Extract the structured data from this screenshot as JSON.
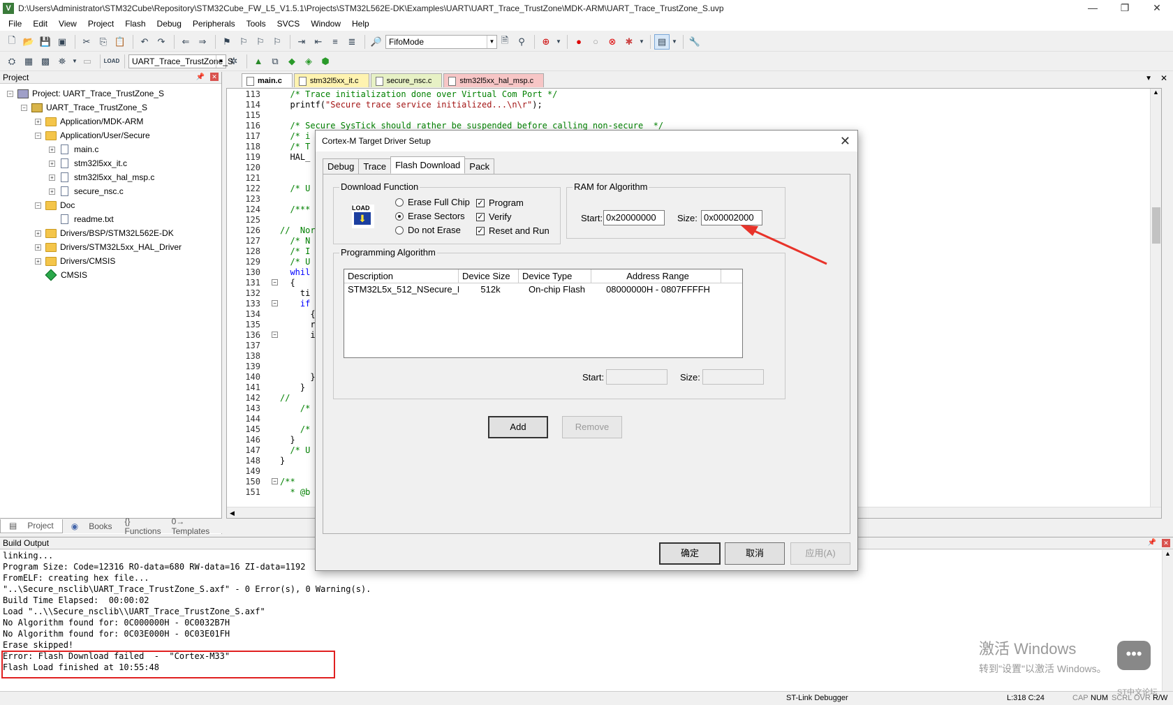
{
  "window": {
    "title": "D:\\Users\\Administrator\\STM32Cube\\Repository\\STM32Cube_FW_L5_V1.5.1\\Projects\\STM32L562E-DK\\Examples\\UART\\UART_Trace_TrustZone\\MDK-ARM\\UART_Trace_TrustZone_S.uvp",
    "app_icon": "V"
  },
  "menu": [
    "File",
    "Edit",
    "View",
    "Project",
    "Flash",
    "Debug",
    "Peripherals",
    "Tools",
    "SVCS",
    "Window",
    "Help"
  ],
  "toolbar": {
    "find_combo": "FifoMode",
    "target_combo": "UART_Trace_TrustZone_S"
  },
  "project_panel": {
    "title": "Project",
    "tree": [
      {
        "label": "Project: UART_Trace_TrustZone_S",
        "icon": "proj",
        "level": 0,
        "exp": "−"
      },
      {
        "label": "UART_Trace_TrustZone_S",
        "icon": "target",
        "level": 1,
        "exp": "−"
      },
      {
        "label": "Application/MDK-ARM",
        "icon": "folder",
        "level": 2,
        "exp": "+"
      },
      {
        "label": "Application/User/Secure",
        "icon": "folder",
        "level": 2,
        "exp": "−"
      },
      {
        "label": "main.c",
        "icon": "file",
        "level": 3,
        "exp": "+"
      },
      {
        "label": "stm32l5xx_it.c",
        "icon": "file",
        "level": 3,
        "exp": "+"
      },
      {
        "label": "stm32l5xx_hal_msp.c",
        "icon": "file",
        "level": 3,
        "exp": "+"
      },
      {
        "label": "secure_nsc.c",
        "icon": "file",
        "level": 3,
        "exp": "+"
      },
      {
        "label": "Doc",
        "icon": "folder",
        "level": 2,
        "exp": "−"
      },
      {
        "label": "readme.txt",
        "icon": "file",
        "level": 3,
        "exp": ""
      },
      {
        "label": "Drivers/BSP/STM32L562E-DK",
        "icon": "folder",
        "level": 2,
        "exp": "+"
      },
      {
        "label": "Drivers/STM32L5xx_HAL_Driver",
        "icon": "folder",
        "level": 2,
        "exp": "+"
      },
      {
        "label": "Drivers/CMSIS",
        "icon": "folder",
        "level": 2,
        "exp": "+"
      },
      {
        "label": "CMSIS",
        "icon": "diamond",
        "level": 2,
        "exp": ""
      }
    ],
    "tabs": [
      "Project",
      "Books",
      "{} Functions",
      "0→ Templates"
    ]
  },
  "editor_tabs": [
    "main.c",
    "stm32l5xx_it.c",
    "secure_nsc.c",
    "stm32l5xx_hal_msp.c"
  ],
  "code_lines": [
    {
      "n": "113",
      "fold": "",
      "code": "  /* Trace initialization done over Virtual Com Port */",
      "cls": "cmt"
    },
    {
      "n": "114",
      "fold": "",
      "code": "  printf(\"Secure trace service initialized...\\n\\r\");",
      "cls": "mixed"
    },
    {
      "n": "115",
      "fold": "",
      "code": "",
      "cls": ""
    },
    {
      "n": "116",
      "fold": "",
      "code": "  /* Secure SysTick should rather be suspended before calling non-secure  */",
      "cls": "cmt"
    },
    {
      "n": "117",
      "fold": "",
      "code": "  /* i",
      "cls": "cmt"
    },
    {
      "n": "118",
      "fold": "",
      "code": "  /* T",
      "cls": "cmt"
    },
    {
      "n": "119",
      "fold": "",
      "code": "  HAL_",
      "cls": ""
    },
    {
      "n": "120",
      "fold": "",
      "code": "",
      "cls": ""
    },
    {
      "n": "121",
      "fold": "",
      "code": "",
      "cls": ""
    },
    {
      "n": "122",
      "fold": "",
      "code": "  /* U",
      "cls": "cmt"
    },
    {
      "n": "123",
      "fold": "",
      "code": "",
      "cls": ""
    },
    {
      "n": "124",
      "fold": "",
      "code": "  /***",
      "cls": "cmt"
    },
    {
      "n": "125",
      "fold": "",
      "code": "",
      "cls": ""
    },
    {
      "n": "126",
      "fold": "",
      "code": "//  Nor",
      "cls": "cmt"
    },
    {
      "n": "127",
      "fold": "",
      "code": "  /* N",
      "cls": "cmt"
    },
    {
      "n": "128",
      "fold": "",
      "code": "  /* I",
      "cls": "cmt"
    },
    {
      "n": "129",
      "fold": "",
      "code": "  /* U",
      "cls": "cmt"
    },
    {
      "n": "130",
      "fold": "",
      "code": "  whil",
      "cls": "kw"
    },
    {
      "n": "131",
      "fold": "−",
      "code": "  {",
      "cls": ""
    },
    {
      "n": "132",
      "fold": "",
      "code": "    ti",
      "cls": ""
    },
    {
      "n": "133",
      "fold": "−",
      "code": "    if",
      "cls": "kw"
    },
    {
      "n": "134",
      "fold": "",
      "code": "      {",
      "cls": ""
    },
    {
      "n": "135",
      "fold": "",
      "code": "      r",
      "cls": ""
    },
    {
      "n": "136",
      "fold": "−",
      "code": "      i",
      "cls": ""
    },
    {
      "n": "137",
      "fold": "",
      "code": "",
      "cls": ""
    },
    {
      "n": "138",
      "fold": "",
      "code": "",
      "cls": ""
    },
    {
      "n": "139",
      "fold": "",
      "code": "",
      "cls": ""
    },
    {
      "n": "140",
      "fold": "",
      "code": "      }",
      "cls": ""
    },
    {
      "n": "141",
      "fold": "",
      "code": "    }",
      "cls": ""
    },
    {
      "n": "142",
      "fold": "",
      "code": "//    ",
      "cls": "cmt"
    },
    {
      "n": "143",
      "fold": "",
      "code": "    /*",
      "cls": "cmt"
    },
    {
      "n": "144",
      "fold": "",
      "code": "",
      "cls": ""
    },
    {
      "n": "145",
      "fold": "",
      "code": "    /*",
      "cls": "cmt"
    },
    {
      "n": "146",
      "fold": "",
      "code": "  }",
      "cls": ""
    },
    {
      "n": "147",
      "fold": "",
      "code": "  /* U",
      "cls": "cmt"
    },
    {
      "n": "148",
      "fold": "",
      "code": "}",
      "cls": ""
    },
    {
      "n": "149",
      "fold": "",
      "code": "",
      "cls": ""
    },
    {
      "n": "150",
      "fold": "−",
      "code": "/**",
      "cls": "cmt"
    },
    {
      "n": "151",
      "fold": "",
      "code": "  * @b",
      "cls": "cmt"
    }
  ],
  "build_output": {
    "title": "Build Output",
    "lines": [
      "linking...",
      "Program Size: Code=12316 RO-data=680 RW-data=16 ZI-data=1192",
      "FromELF: creating hex file...",
      "\"..\\Secure_nsclib\\UART_Trace_TrustZone_S.axf\" - 0 Error(s), 0 Warning(s).",
      "Build Time Elapsed:  00:00:02",
      "Load \"..\\\\Secure_nsclib\\\\UART_Trace_TrustZone_S.axf\"",
      "No Algorithm found for: 0C000000H - 0C0032B7H",
      "No Algorithm found for: 0C03E000H - 0C03E01FH",
      "Erase skipped!",
      "Error: Flash Download failed  -  \"Cortex-M33\"",
      "Flash Load finished at 10:55:48"
    ]
  },
  "watermark": {
    "line1": "激活 Windows",
    "line2": "转到\"设置\"以激活 Windows。"
  },
  "status": {
    "debugger": "ST-Link Debugger",
    "position": "L:318 C:24",
    "caps": "CAP",
    "num": "NUM",
    "scrl": "SCRL",
    "ovr": "OVR",
    "rw": "R/W",
    "forum": "ST中文论坛"
  },
  "dialog": {
    "title": "Cortex-M Target Driver Setup",
    "tabs": [
      "Debug",
      "Trace",
      "Flash Download",
      "Pack"
    ],
    "download_function": {
      "legend": "Download Function",
      "load_icon_text": "LOAD",
      "radios": [
        {
          "label": "Erase Full Chip",
          "checked": false
        },
        {
          "label": "Erase Sectors",
          "checked": true
        },
        {
          "label": "Do not Erase",
          "checked": false
        }
      ],
      "checks": [
        {
          "label": "Program",
          "checked": true
        },
        {
          "label": "Verify",
          "checked": true
        },
        {
          "label": "Reset and Run",
          "checked": true
        }
      ]
    },
    "ram": {
      "legend": "RAM for Algorithm",
      "start_label": "Start:",
      "start_value": "0x20000000",
      "size_label": "Size:",
      "size_value": "0x00002000"
    },
    "algorithm": {
      "legend": "Programming Algorithm",
      "columns": [
        "Description",
        "Device Size",
        "Device Type",
        "Address Range"
      ],
      "rows": [
        {
          "description": "STM32L5x_512_NSecure_F...",
          "size": "512k",
          "type": "On-chip Flash",
          "range": "08000000H - 0807FFFFH"
        }
      ],
      "start_label": "Start:",
      "size_label": "Size:",
      "start_value": "",
      "size_value": ""
    },
    "buttons": {
      "add": "Add",
      "remove": "Remove",
      "ok": "确定",
      "cancel": "取消",
      "apply": "应用(A)"
    }
  },
  "colors": {
    "annotation_red": "#e8332a",
    "comment_green": "#008000",
    "string_red": "#a31515",
    "keyword_blue": "#0000ff"
  }
}
